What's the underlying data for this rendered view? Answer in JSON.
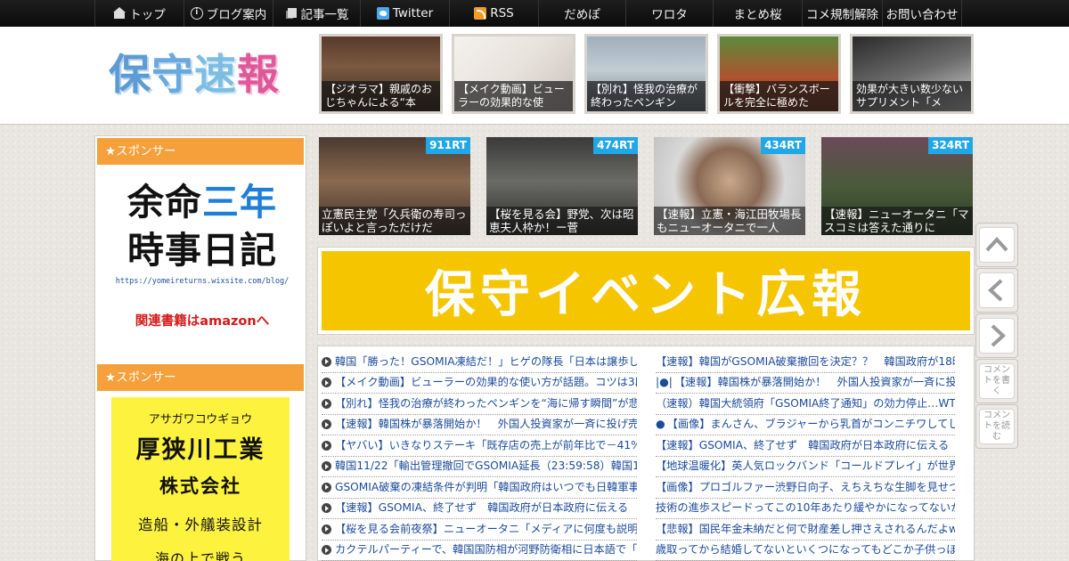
{
  "nav": {
    "items": [
      {
        "icon": "home-icon",
        "label": "トップ"
      },
      {
        "icon": "info-icon",
        "label": "ブログ案内"
      },
      {
        "icon": "list-icon",
        "label": "記事一覧"
      },
      {
        "icon": "twitter-icon",
        "label": "Twitter"
      },
      {
        "icon": "rss-icon",
        "label": "RSS"
      },
      {
        "icon": "",
        "label": "だめぽ"
      },
      {
        "icon": "",
        "label": "ワロタ"
      },
      {
        "icon": "",
        "label": "まとめ桜"
      },
      {
        "icon": "",
        "label": "コメ規制解除"
      },
      {
        "icon": "",
        "label": "お問い合わせ"
      }
    ]
  },
  "logo": {
    "chars": [
      "保",
      "守",
      "速",
      "報"
    ]
  },
  "header_articles": [
    {
      "caption": "【ジオラマ】親戚のおじちゃんによる“本"
    },
    {
      "caption": "【メイク動画】ビューラーの効果的な使"
    },
    {
      "caption": "【別れ】怪我の治療が終わったペンギン"
    },
    {
      "caption": "【衝撃】バランスボールを完全に極めた"
    },
    {
      "caption": "効果が大きい数少ないサプリメント「メ"
    }
  ],
  "ranking": [
    {
      "rt": "911RT",
      "caption": "立憲民主党「久兵衛の寿司っぽいよと言っただけだ"
    },
    {
      "rt": "474RT",
      "caption": "【桜を見る会】野党、次は昭恵夫人枠か！ー菅"
    },
    {
      "rt": "434RT",
      "caption": "【速報】立憲・海江田牧場長もニューオータニで一人"
    },
    {
      "rt": "324RT",
      "caption": "【速報】ニューオータニ「マスコミは答えた通りに"
    }
  ],
  "sidebar": {
    "sponsor_label": "★スポンサー",
    "ad1": {
      "line1_a": "余命",
      "line1_b": "三年",
      "line2": "時事日記",
      "url": "https://yomeireturns.wixsite.com/blog/",
      "amazon": "関連書籍はamazonへ"
    },
    "ad2": {
      "kana": "アサガワコウギョウ",
      "name": "厚狭川工業",
      "kk": "株式会社",
      "service": "造船・外艤装設計",
      "more": "海の上で戦う"
    }
  },
  "banner": {
    "text": "保守イベント広報"
  },
  "left_headlines": [
    "韓国「勝った！GSOMIA凍結だ！」ヒゲの隊長「日本は譲歩し",
    "【メイク動画】ビューラーの効果的な使い方が話題。コツは3段",
    "【別れ】怪我の治療が終わったペンギンを“海に帰す瞬間”が悲",
    "【速報】韓国株が暴落開始か！　外国人投資家が一斉に投げ売",
    "【ヤバい】いきなりステーキ「既存店の売上が前年比で－41%",
    "韓国11/22「輸出管理撤回でGSOMIA延長（23:59:58）韓国11/23",
    "GSOMIA破棄の凍結条件が判明「韓国政府はいつでも日韓軍事",
    "【速報】GSOMIA、終了せず　韓国政府が日本政府に伝える",
    "【桜を見る会前夜祭】ニューオータニ「メディアに何度も説明",
    "カクテルパーティーで、韓国国防相が河野防衛相に日本語で「"
  ],
  "right_headlines": [
    {
      "prefix": "",
      "text": "【速報】韓国がGSOMIA破棄撤回を決定？？　韓国政府が18時"
    },
    {
      "prefix": "|●|",
      "text": "【速報】韓国株が暴落開始か！　外国人投資家が一斉に投げ"
    },
    {
      "prefix": "",
      "text": "（速報）韓国大統領府「GSOMIA終了通知」の効力停止…WTO"
    },
    {
      "prefix": "●",
      "text": "【画像】まんさん、ブラジャーから乳首がコンニチワしてしま"
    },
    {
      "prefix": "",
      "text": "【速報】GSOMIA、終了せず　韓国政府が日本政府に伝える"
    },
    {
      "prefix": "",
      "text": "【地球温暖化】英人気ロックバンド「コールドプレイ」が世界"
    },
    {
      "prefix": "",
      "text": "【画像】プロゴルファー渋野日向子、えちえちな生脚を見せつ"
    },
    {
      "prefix": "",
      "text": "技術の進歩スピードってこの10年あたり緩やかになってないか"
    },
    {
      "prefix": "",
      "text": "【悲報】国民年金未納だと何で財産差し押さえされるんだよw"
    },
    {
      "prefix": "",
      "text": "歳取ってから結婚してないといくつになってもどこか子供っぽ"
    }
  ],
  "float_buttons": {
    "comment_write": "コメントを書く",
    "comment_read": "コメントを読む"
  }
}
